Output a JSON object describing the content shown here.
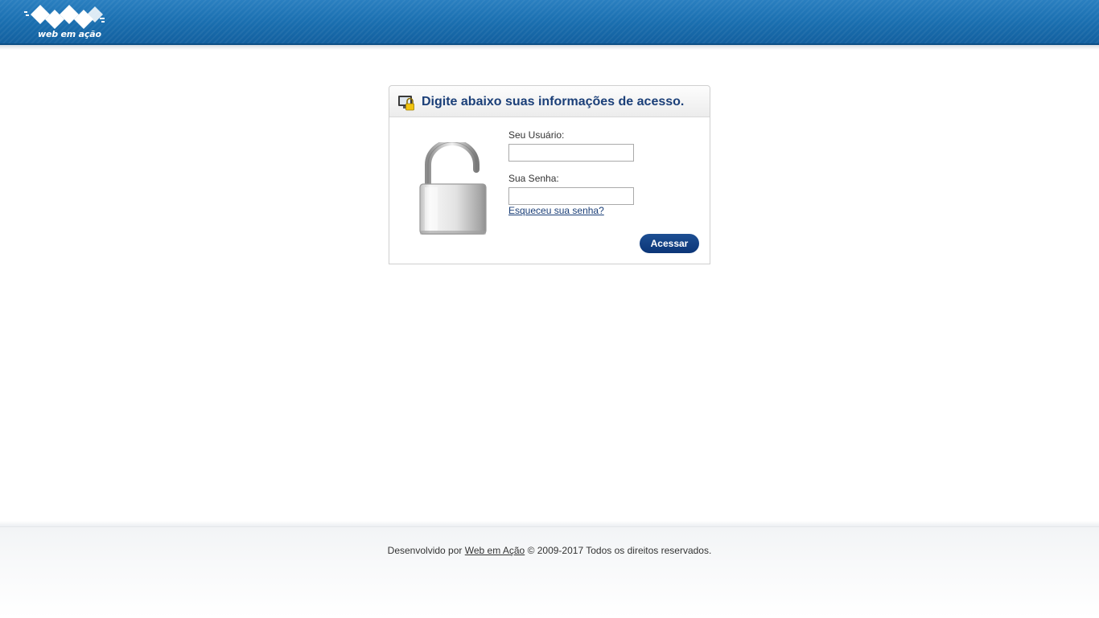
{
  "header": {
    "logo_text": "web em ação",
    "bar_color": "#1a6fb0"
  },
  "login": {
    "title": "Digite abaixo suas informações de acesso.",
    "username_label": "Seu Usuário:",
    "username_value": "",
    "password_label": "Sua Senha:",
    "password_value": "",
    "forgot_link": "Esqueceu sua senha?",
    "submit_label": "Acessar",
    "title_color": "#1b3f78",
    "button_color": "#0b3577"
  },
  "footer": {
    "prefix": "Desenvolvido por",
    "link_text": "Web em Ação",
    "suffix": "© 2009-2017 Todos os direitos reservados."
  },
  "icons": {
    "header_icon": "monitor-lock-icon",
    "lock_icon": "open-padlock-icon",
    "logo": "web-em-acao-logo"
  }
}
